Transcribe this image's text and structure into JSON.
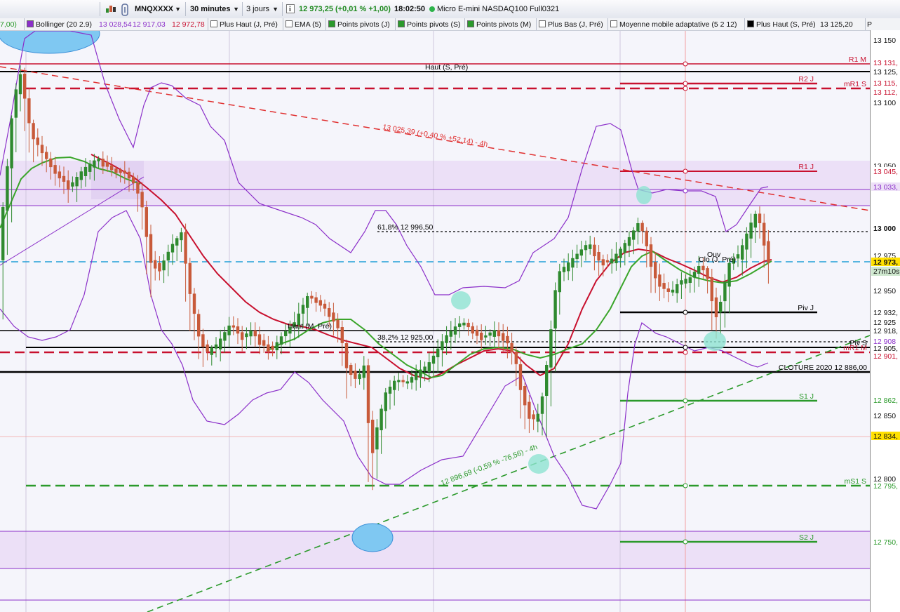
{
  "toolbar": {
    "symbol": "MNQXXXX",
    "timeframe": "30 minutes",
    "period": "3 jours",
    "info_icon": "info-icon",
    "price_change": "12 973,25 (+0,01 % +1,00)",
    "time": "18:02:50",
    "status_color": "#2db34a",
    "instrument": "Micro E-mini NASDAQ100 Full0321"
  },
  "legend": {
    "items": [
      {
        "label": "7,00)",
        "color": "#2b9a2b"
      },
      {
        "label": "Bollinger (20 2.9)",
        "color": "#8b2fc9"
      },
      {
        "label": "13 028,54",
        "color": "#8b2fc9"
      },
      {
        "label": "12 917,03",
        "color": "#8b2fc9"
      },
      {
        "label": "12 972,78",
        "color": "#c8102e"
      },
      {
        "label": "Plus Haut (J, Pré)",
        "color": "#ffffff"
      },
      {
        "label": "EMA (5)",
        "color": "#ffffff"
      },
      {
        "label": "Points pivots (J)",
        "color": "#2b9a2b"
      },
      {
        "label": "Points pivots (S)",
        "color": "#2b9a2b"
      },
      {
        "label": "Points pivots (M)",
        "color": "#2b9a2b"
      },
      {
        "label": "Plus Bas (J, Pré)",
        "color": "#ffffff"
      },
      {
        "label": "Moyenne mobile adaptative (5 2 12)",
        "color": "#ffffff"
      },
      {
        "label": "Plus Haut (S, Pré)",
        "color": "#000000"
      },
      {
        "label": "13 125,20",
        "color": "#111111"
      }
    ]
  },
  "axis": {
    "ticks": [
      "13 150",
      "13 100",
      "13 050",
      "13 000",
      "12 975",
      "12 950",
      "12 925",
      "12 850",
      "12 800"
    ],
    "labels": [
      {
        "text": "13 131,",
        "fg": "#c8102e",
        "bg": "#ffffff"
      },
      {
        "text": "13 125,",
        "fg": "#111111",
        "bg": "#ffffff"
      },
      {
        "text": "13 115,",
        "fg": "#c8102e",
        "bg": "#ffffff"
      },
      {
        "text": "13 112,",
        "fg": "#c8102e",
        "bg": "#ffffff"
      },
      {
        "text": "13 045,",
        "fg": "#c8102e",
        "bg": "#ffffff"
      },
      {
        "text": "13 033,",
        "fg": "#8b2fc9",
        "bg": "#ede0f7"
      },
      {
        "text": "12 973,",
        "fg": "#111111",
        "bg": "#ffe000"
      },
      {
        "text": "27m10s",
        "fg": "#111111",
        "bg": "#cfe8cf"
      },
      {
        "text": "12 932,",
        "fg": "#111111",
        "bg": "#ffffff"
      },
      {
        "text": "12 918,",
        "fg": "#111111",
        "bg": "#ffffff"
      },
      {
        "text": "12 908",
        "fg": "#8b2fc9",
        "bg": "#ffffff"
      },
      {
        "text": "12 905,",
        "fg": "#111111",
        "bg": "#ffffff"
      },
      {
        "text": "12 901,",
        "fg": "#c8102e",
        "bg": "#ffffff"
      },
      {
        "text": "12 862,",
        "fg": "#2b9a2b",
        "bg": "#ffffff"
      },
      {
        "text": "12 834,",
        "fg": "#111111",
        "bg": "#ffe000"
      },
      {
        "text": "12 795,",
        "fg": "#2b9a2b",
        "bg": "#ffffff"
      },
      {
        "text": "12 750,",
        "fg": "#2b9a2b",
        "bg": "#ffffff"
      }
    ]
  },
  "levels": {
    "r1m": "R1 M",
    "haut_s_pre": "Haut (S, Pré)",
    "r2j": "R2 J",
    "mr1s": "mR1 S",
    "r1j": "R1 J",
    "fib618": "61,8% 12 996,50",
    "fib382": "38,2% 12 925,00",
    "pivj": "Piv J",
    "pivs": "Piv S",
    "mr1m": "mR1 M",
    "ouv": "Ouv",
    "clo": "Clo (J, Pré)",
    "haut_m_pre": "Haut (M, Pré)",
    "cloture": "CLOTURE 2020 12 886,00",
    "s1j": "S1 J",
    "ms1s": "mS1 S",
    "s2j": "S2 J",
    "trend_down": "13 025,39 (+0,40 % +52,14) - 4h",
    "trend_up": "12 896,69 (-0,59 % -76,56) - 4h"
  },
  "colors": {
    "up_candle": "#2f8a2f",
    "down_candle": "#c85a3a",
    "bollinger": "#8b2fc9",
    "ema": "#c8102e",
    "ama": "#3aa52a",
    "resistance": "#c8102e",
    "support": "#2b9a2b",
    "last_price_line": "#22a0d8",
    "band_fill": "#efe3fa"
  }
}
